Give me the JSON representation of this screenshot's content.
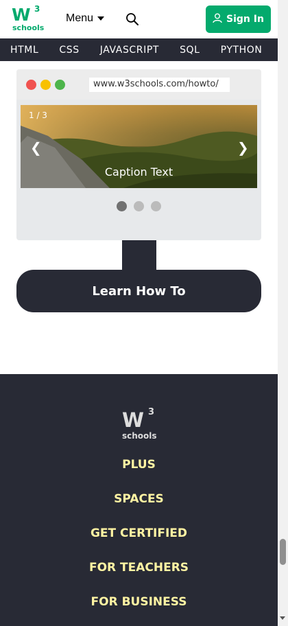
{
  "header": {
    "logo_main": "W",
    "logo_sup": "3",
    "logo_sub": "schools",
    "menu_label": "Menu",
    "signin_label": "Sign In",
    "brand_color": "#04AA6D",
    "search_icon": "search-icon",
    "user_icon": "user-icon"
  },
  "nav": {
    "items": [
      "HTML",
      "CSS",
      "JAVASCRIPT",
      "SQL",
      "PYTHON"
    ]
  },
  "howto": {
    "url": "www.w3schools.com/howto/",
    "slide_counter": "1 / 3",
    "prev_arrow": "❮",
    "next_arrow": "❯",
    "caption": "Caption Text",
    "active_dot": 1,
    "dot_count": 3,
    "window_dot_colors": [
      "#F0524F",
      "#F8C100",
      "#4DB54B"
    ],
    "learn_button": "Learn How To"
  },
  "footer": {
    "logo_main": "W",
    "logo_sup": "3",
    "logo_sub": "schools",
    "links": [
      "PLUS",
      "SPACES",
      "GET CERTIFIED",
      "FOR TEACHERS",
      "FOR BUSINESS"
    ],
    "link_color": "#FFF4A3",
    "background": "#282A35"
  }
}
